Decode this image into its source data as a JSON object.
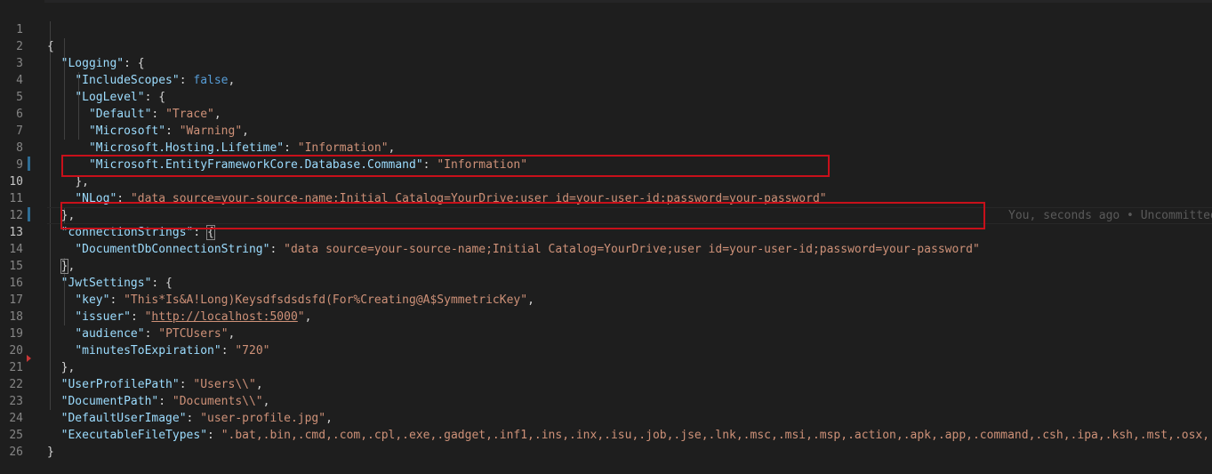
{
  "editor": {
    "line_numbers": [
      "1",
      "2",
      "3",
      "4",
      "5",
      "6",
      "7",
      "8",
      "9",
      "10",
      "11",
      "12",
      "13",
      "14",
      "15",
      "16",
      "17",
      "18",
      "19",
      "20",
      "21",
      "22",
      "23",
      "24",
      "25",
      "26"
    ],
    "blame_text": "You, seconds ago • Uncommitted"
  },
  "code": {
    "l1_open": "{",
    "logging_key": "\"Logging\"",
    "include_scopes_key": "\"IncludeScopes\"",
    "include_scopes_val": "false",
    "loglevel_key": "\"LogLevel\"",
    "default_key": "\"Default\"",
    "default_val": "\"Trace\"",
    "microsoft_key": "\"Microsoft\"",
    "microsoft_val": "\"Warning\"",
    "hosting_key": "\"Microsoft.Hosting.Lifetime\"",
    "hosting_val": "\"Information\"",
    "efcore_key": "\"Microsoft.EntityFrameworkCore.Database.Command\"",
    "efcore_val": "\"Information\"",
    "nlog_key": "\"NLog\"",
    "nlog_val": "\"data source=your-source-name;Initial Catalog=YourDrive;user id=your-user-id;password=your-password\"",
    "connstr_key": "\"connectionStrings\"",
    "docdb_key": "\"DocumentDbConnectionString\"",
    "docdb_val": "\"data source=your-source-name;Initial Catalog=YourDrive;user id=your-user-id;password=your-password\"",
    "jwt_key": "\"JwtSettings\"",
    "key_key": "\"key\"",
    "key_val": "\"This*Is&A!Long)Keysdfsdsdsfd(For%Creating@A$SymmetricKey\"",
    "issuer_key": "\"issuer\"",
    "issuer_val_q": "\"",
    "issuer_val_url": "http://localhost:5000",
    "audience_key": "\"audience\"",
    "audience_val": "\"PTCUsers\"",
    "minutes_key": "\"minutesToExpiration\"",
    "minutes_val": "\"720\"",
    "userprofile_key": "\"UserProfilePath\"",
    "userprofile_val": "\"Users\\\\\"",
    "docpath_key": "\"DocumentPath\"",
    "docpath_val": "\"Documents\\\\\"",
    "defaultimg_key": "\"DefaultUserImage\"",
    "defaultimg_val": "\"user-profile.jpg\"",
    "exec_key": "\"ExecutableFileTypes\"",
    "exec_val": "\".bat,.bin,.cmd,.com,.cpl,.exe,.gadget,.inf1,.ins,.inx,.isu,.job,.jse,.lnk,.msc,.msi,.msp,.action,.apk,.app,.command,.csh,.ipa,.ksh,.mst,.osx,.out",
    "close_brace": "}"
  },
  "colors": {
    "background": "#1e1e1e",
    "key": "#9cdcfe",
    "string": "#ce9178",
    "keyword": "#569cd6",
    "highlight_box": "#c8101a"
  }
}
